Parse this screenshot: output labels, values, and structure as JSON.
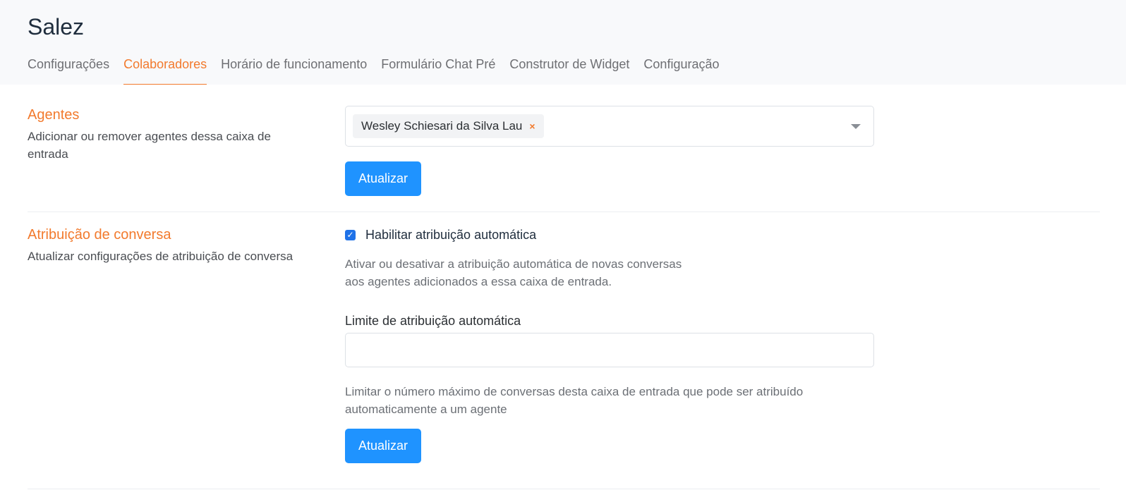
{
  "header": {
    "title": "Salez",
    "tabs": [
      {
        "label": "Configurações",
        "active": false
      },
      {
        "label": "Colaboradores",
        "active": true
      },
      {
        "label": "Horário de funcionamento",
        "active": false
      },
      {
        "label": "Formulário Chat Pré",
        "active": false
      },
      {
        "label": "Construtor de Widget",
        "active": false
      },
      {
        "label": "Configuração",
        "active": false
      }
    ]
  },
  "agents": {
    "title": "Agentes",
    "description": "Adicionar ou remover agentes dessa caixa de entrada",
    "selected": [
      "Wesley Schiesari da Silva Lau"
    ],
    "remove_glyph": "×",
    "update_label": "Atualizar"
  },
  "assignment": {
    "title": "Atribuição de conversa",
    "description": "Atualizar configurações de atribuição de conversa",
    "auto_assign_label": "Habilitar atribuição automática",
    "auto_assign_checked": true,
    "auto_assign_help_line1": "Ativar ou desativar a atribuição automática de novas conversas",
    "auto_assign_help_line2": "aos agentes adicionados a essa caixa de entrada.",
    "limit_label": "Limite de atribuição automática",
    "limit_value": "",
    "limit_placeholder": "",
    "limit_help_line1": "Limitar o número máximo de conversas desta caixa de entrada que pode ser atribuído",
    "limit_help_line2": "automaticamente a um agente",
    "update_label": "Atualizar"
  },
  "colors": {
    "accent": "#f27a2d",
    "primary_button": "#1f93ff",
    "checkbox": "#1f72e8",
    "header_bg": "#f8f9fb"
  }
}
